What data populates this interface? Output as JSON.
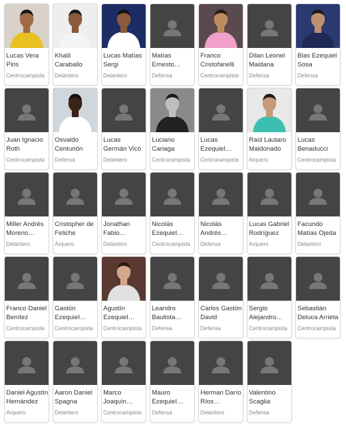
{
  "colors": {
    "placeholder_bg": "#444444",
    "placeholder_icon": "#777777",
    "card_border": "#d9d9d9",
    "name_text": "#333333",
    "position_text": "#888888"
  },
  "players": [
    {
      "name": "Lucas Vera Piris",
      "position": "Centrocampista",
      "photo": "photo"
    },
    {
      "name": "Khalil Caraballo",
      "position": "Delantero",
      "photo": "photo"
    },
    {
      "name": "Lucas Matías Sergi",
      "position": "Delantero",
      "photo": "photo"
    },
    {
      "name": "Matías Ernesto Escudero",
      "position": "Defensa",
      "photo": "placeholder-icon"
    },
    {
      "name": "Franco Cristofanelli",
      "position": "Centrocampista",
      "photo": "photo"
    },
    {
      "name": "Dilan Leonel Maidana",
      "position": "Defensa",
      "photo": "placeholder-icon"
    },
    {
      "name": "Blas Ezequiel Sosa",
      "position": "Defensa",
      "photo": "photo"
    },
    {
      "name": "Juan Ignacio Roth",
      "position": "Centrocampista",
      "photo": "placeholder-icon"
    },
    {
      "name": "Osvaldo Centurión",
      "position": "Defensa",
      "photo": "photo"
    },
    {
      "name": "Lucas Germán Vicó",
      "position": "Delantero",
      "photo": "placeholder-icon"
    },
    {
      "name": "Luciano Cariaga",
      "position": "Centrocampista",
      "photo": "photo"
    },
    {
      "name": "Lucas Ezequiel Chiapparo…",
      "position": "Centrocampista",
      "photo": "placeholder-icon"
    },
    {
      "name": "Raúl Lautaro Maldonado",
      "position": "Arquero",
      "photo": "photo"
    },
    {
      "name": "Lucas Benaducci",
      "position": "Centrocampista",
      "photo": "placeholder-icon"
    },
    {
      "name": "Miller Andrés Moreno Murillo",
      "position": "Delantero",
      "photo": "placeholder-icon"
    },
    {
      "name": "Cristopher de Feliche",
      "position": "Arquero",
      "photo": "placeholder-icon"
    },
    {
      "name": "Jonathan Fabio…",
      "position": "Delantero",
      "photo": "placeholder-icon"
    },
    {
      "name": "Nicolás Ezequiel…",
      "position": "Centrocampista",
      "photo": "placeholder-icon"
    },
    {
      "name": "Nicolás Andrés Barrera",
      "position": "Defensa",
      "photo": "placeholder-icon"
    },
    {
      "name": "Lucas Gabriel Rodríguez",
      "position": "Arquero",
      "photo": "placeholder-icon"
    },
    {
      "name": "Facundo Matías Ojeda",
      "position": "Delantero",
      "photo": "placeholder-icon"
    },
    {
      "name": "Franco Daniel Benítez",
      "position": "Centrocampista",
      "photo": "placeholder-icon"
    },
    {
      "name": "Gastón Ezequiel…",
      "position": "Centrocampista",
      "photo": "placeholder-icon"
    },
    {
      "name": "Agustín Ezequiel…",
      "position": "Centrocampista",
      "photo": "photo"
    },
    {
      "name": "Leandro Bautista…",
      "position": "Defensa",
      "photo": "placeholder-icon"
    },
    {
      "name": "Carlos Gastón David",
      "position": "Defensa",
      "photo": "placeholder-icon"
    },
    {
      "name": "Sergio Alejandro Díaz",
      "position": "Centrocampista",
      "photo": "placeholder-icon"
    },
    {
      "name": "Sebastián Deluca Arrieta",
      "position": "Centrocampista",
      "photo": "placeholder-icon"
    },
    {
      "name": "Daniel Agustín Hernández",
      "position": "Arquero",
      "photo": "placeholder-icon"
    },
    {
      "name": "Aaron Daniel Spagna",
      "position": "Delantero",
      "photo": "placeholder-icon"
    },
    {
      "name": "Marco Joaquín Camejo",
      "position": "Centrocampista",
      "photo": "placeholder-icon"
    },
    {
      "name": "Mauro Ezequiel…",
      "position": "Defensa",
      "photo": "placeholder-icon"
    },
    {
      "name": "Herman Darío Ríos…",
      "position": "Delantero",
      "photo": "placeholder-icon"
    },
    {
      "name": "Valentino Scaglia",
      "position": "Defensa",
      "photo": "placeholder-icon"
    }
  ]
}
